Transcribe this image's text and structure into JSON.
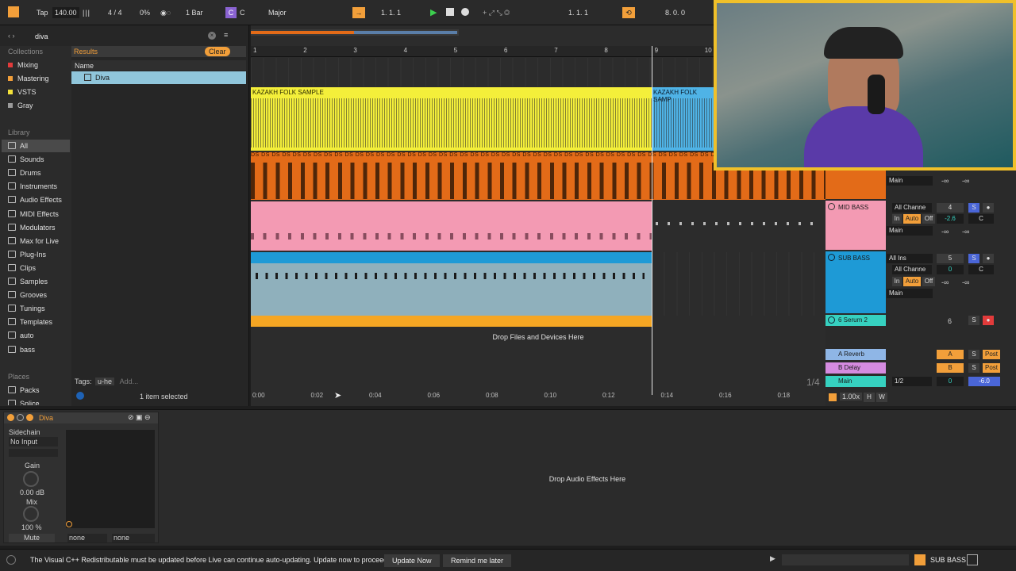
{
  "colors": {
    "accent": "#f29f3a",
    "yellow": "#f4ef3a",
    "orange": "#e36b18",
    "pink": "#f39ab3",
    "blue": "#1e9ad6",
    "purple": "#8a63d2"
  },
  "toolbar": {
    "tap": "Tap",
    "tempo": "140.00",
    "time_sig": "4 / 4",
    "percent": "0%",
    "quantize": "1 Bar",
    "key_badge": "C",
    "key": "C",
    "scale": "Major",
    "position": "1.  1.  1",
    "position2": "1.  1.  1",
    "loop_len": "8.  0.  0"
  },
  "browser": {
    "search_value": "diva",
    "clear_label": "Clear",
    "collections_heading": "Collections",
    "collections": [
      {
        "label": "Mixing",
        "color": "#e23b3b"
      },
      {
        "label": "Mastering",
        "color": "#f29f3a"
      },
      {
        "label": "VSTS",
        "color": "#f4e23a"
      },
      {
        "label": "Gray",
        "color": "#9a9a9a"
      }
    ],
    "library_heading": "Library",
    "library": [
      "All",
      "Sounds",
      "Drums",
      "Instruments",
      "Audio Effects",
      "MIDI Effects",
      "Modulators",
      "Max for Live",
      "Plug-Ins",
      "Clips",
      "Samples",
      "Grooves",
      "Tunings",
      "Templates",
      "auto",
      "bass"
    ],
    "places_heading": "Places",
    "places": [
      "Packs",
      "Splice"
    ],
    "results_label": "Results",
    "name_header": "Name",
    "result_item": "Diva",
    "tags_label": "Tags:",
    "tag": "u-he",
    "add_tag": "Add...",
    "status": "1 item selected"
  },
  "arrangement": {
    "bars": [
      "1",
      "2",
      "3",
      "4",
      "5",
      "6",
      "7",
      "8",
      "9",
      "10"
    ],
    "times": [
      "0:00",
      "0:02",
      "0:04",
      "0:06",
      "0:08",
      "0:10",
      "0:12",
      "0:14",
      "0:16",
      "0:18"
    ],
    "clip_kazakh": "KAZAKH FOLK SAMPLE",
    "clip_kazakh2": "KAZAKH FOLK SAMP",
    "ds_label": "DS DS DS DS DS DS DS DS DS DS DS DS DS DS DS DS DS DS DS DS DS DS DS DS DS DS DS DS DS DS DS DS DS DS DS DS DS DS DS DS DS DS DS DS DS DS DS",
    "drop_files": "Drop Files and Devices Here",
    "zoom_label": "1/4"
  },
  "mixer": {
    "tracks": [
      {
        "name": "MID BASS",
        "color": "#f39ab3",
        "number": "4",
        "vol": "-2.6",
        "pan": "C",
        "output": "Main",
        "input": "All Channe",
        "in_label": "In",
        "auto_label": "Auto",
        "off_label": "Off"
      },
      {
        "name": "SUB BASS",
        "color": "#1e9ad6",
        "number": "5",
        "vol": "0",
        "pan": "C",
        "output": "Main",
        "input": "All Ins",
        "input2": "All Channe",
        "in_label": "In",
        "auto_label": "Auto",
        "off_label": "Off"
      },
      {
        "name": "6 Serum 2",
        "color": "#36d1c0",
        "number": "6"
      }
    ],
    "returns": [
      {
        "name": "A Reverb",
        "letter": "A",
        "post": "Post"
      },
      {
        "name": "B Delay",
        "letter": "B",
        "post": "Post"
      }
    ],
    "main": {
      "name": "Main",
      "output": "1/2",
      "vol": "0",
      "db": "-6.0"
    },
    "top_output": "Main",
    "neg_inf": "-∞",
    "solo": "S",
    "zoom_readout": "1.00x",
    "h_btn": "H",
    "w_btn": "W"
  },
  "device": {
    "name": "Diva",
    "sidechain_label": "Sidechain",
    "sidechain_value": "No Input",
    "gain_label": "Gain",
    "gain_value": "0.00 dB",
    "mix_label": "Mix",
    "mix_value": "100 %",
    "mute": "Mute",
    "none1": "none",
    "none2": "none",
    "drop_audio": "Drop Audio Effects Here"
  },
  "statusbar": {
    "message": "The Visual C++ Redistributable must be updated before Live can continue auto-updating. Update now to proceed.",
    "update_now": "Update Now",
    "remind_later": "Remind me later",
    "track_label": "SUB BASS"
  }
}
